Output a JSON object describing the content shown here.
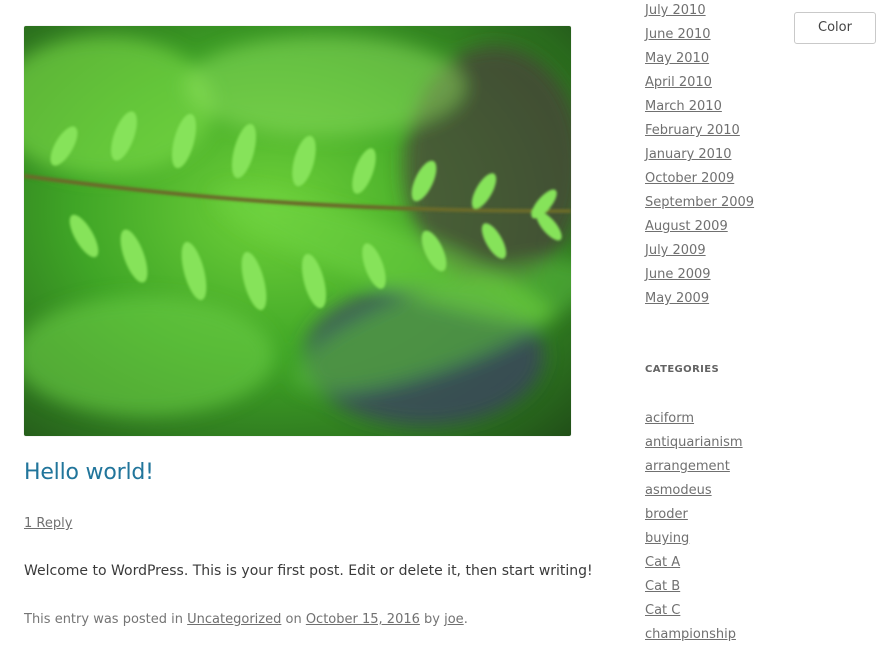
{
  "post": {
    "image_alt": "green fern frond",
    "title": "Hello world!",
    "reply_link": "1 Reply",
    "content": "Welcome to WordPress. This is your first post. Edit or delete it, then start writing!",
    "meta": {
      "prefix": "This entry was posted in ",
      "category": "Uncategorized",
      "on": " on ",
      "date": "October 15, 2016",
      "by": " by ",
      "author": "joe",
      "suffix": "."
    }
  },
  "sidebar": {
    "archives": [
      "July 2010",
      "June 2010",
      "May 2010",
      "April 2010",
      "March 2010",
      "February 2010",
      "January 2010",
      "October 2009",
      "September 2009",
      "August 2009",
      "July 2009",
      "June 2009",
      "May 2009"
    ],
    "categories_heading": "CATEGORIES",
    "categories": [
      "aciform",
      "antiquarianism",
      "arrangement",
      "asmodeus",
      "broder",
      "buying",
      "Cat A",
      "Cat B",
      "Cat C",
      "championship"
    ]
  },
  "toolbar": {
    "color_button": "Color"
  },
  "colors": {
    "title_link": "#21759b",
    "link": "#707070",
    "accent": "#4caf50"
  }
}
